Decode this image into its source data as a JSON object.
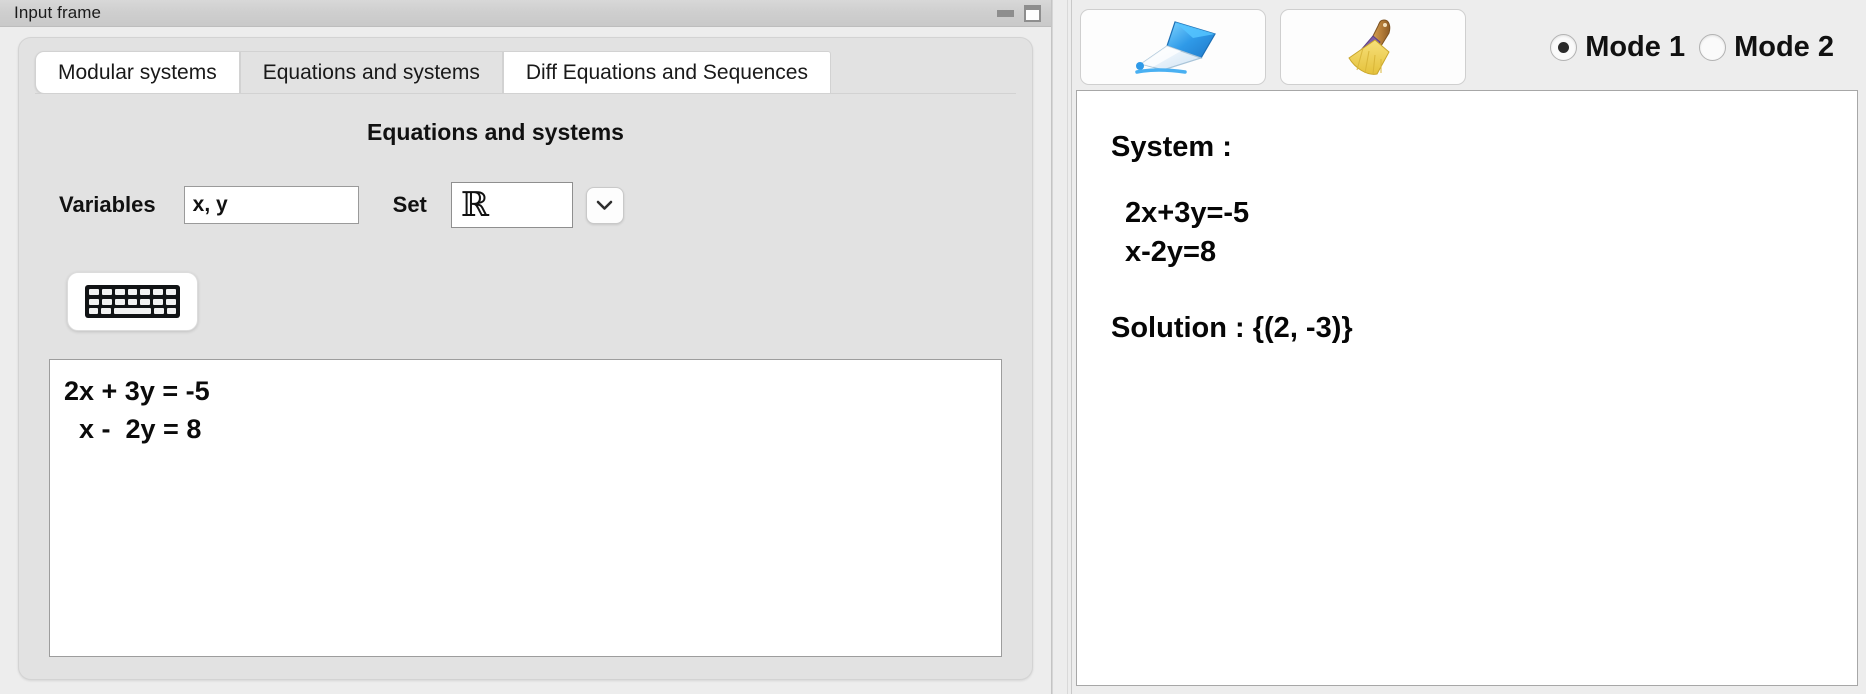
{
  "window": {
    "title": "Input frame",
    "minimize_icon": "minimize-icon",
    "maximize_icon": "maximize-icon"
  },
  "tabs": [
    {
      "label": "Modular systems",
      "selected": false
    },
    {
      "label": "Equations and systems",
      "selected": true
    },
    {
      "label": "Diff Equations and Sequences",
      "selected": false
    }
  ],
  "panel": {
    "section_title": "Equations and systems",
    "variables_label": "Variables",
    "variables_value": "x, y",
    "variables_placeholder": "",
    "set_label": "Set",
    "set_value": "ℝ",
    "set_dropdown_icon": "chevron-down-icon",
    "keyboard_button_icon": "keyboard-icon",
    "equations_value": "2x + 3y = -5\n  x -  2y = 8",
    "equations_placeholder": ""
  },
  "toolbar": {
    "solve_icon": "pen-icon",
    "clear_icon": "broom-icon",
    "modes": [
      {
        "label": "Mode 1",
        "checked": true
      },
      {
        "label": "Mode 2",
        "checked": false
      }
    ]
  },
  "output": {
    "system_heading": "System :",
    "system_equations": "2x+3y=-5\nx-2y=8",
    "solution_text": "Solution : {(2, -3)}"
  },
  "colors": {
    "window_bg": "#ededed",
    "group_bg": "#e2e2e2",
    "field_bg": "#ffffff",
    "text": "#111111",
    "pen_blue": "#3aa8f0",
    "broom_yellow": "#f2d24a"
  }
}
